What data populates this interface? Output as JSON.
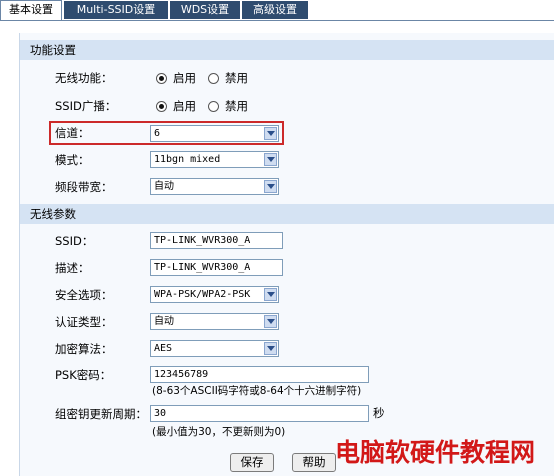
{
  "tabs": [
    {
      "label": "基本设置",
      "active": true
    },
    {
      "label": "Multi-SSID设置",
      "active": false
    },
    {
      "label": "WDS设置",
      "active": false
    },
    {
      "label": "高级设置",
      "active": false
    }
  ],
  "sections": {
    "function": "功能设置",
    "wireless_params": "无线参数"
  },
  "wireless_function": {
    "label": "无线功能：",
    "options": [
      "启用",
      "禁用"
    ],
    "selected": "启用"
  },
  "ssid_broadcast": {
    "label": "SSID广播：",
    "options": [
      "启用",
      "禁用"
    ],
    "selected": "启用"
  },
  "channel": {
    "label": "信道：",
    "value": "6"
  },
  "mode": {
    "label": "模式：",
    "value": "11bgn mixed"
  },
  "bandwidth": {
    "label": "频段带宽：",
    "value": "自动"
  },
  "ssid": {
    "label": "SSID：",
    "value": "TP-LINK_WVR300_A"
  },
  "description": {
    "label": "描述：",
    "value": "TP-LINK_WVR300_A"
  },
  "security": {
    "label": "安全选项：",
    "value": "WPA-PSK/WPA2-PSK"
  },
  "auth_type": {
    "label": "认证类型：",
    "value": "自动"
  },
  "encryption": {
    "label": "加密算法：",
    "value": "AES"
  },
  "psk": {
    "label": "PSK密码：",
    "value": "123456789",
    "hint": "(8-63个ASCII码字符或8-64个十六进制字符)"
  },
  "group_key": {
    "label": "组密钥更新周期：",
    "value": "30",
    "unit": "秒",
    "hint": "(最小值为30，不更新则为0)"
  },
  "buttons": {
    "save": "保存",
    "help": "帮助"
  },
  "watermark": "电脑软硬件教程网",
  "colors": {
    "tab_bg": "#2f4c6f",
    "section_bg": "#d5e3f3",
    "highlight": "#cc2a2a",
    "watermark": "#d21818"
  }
}
